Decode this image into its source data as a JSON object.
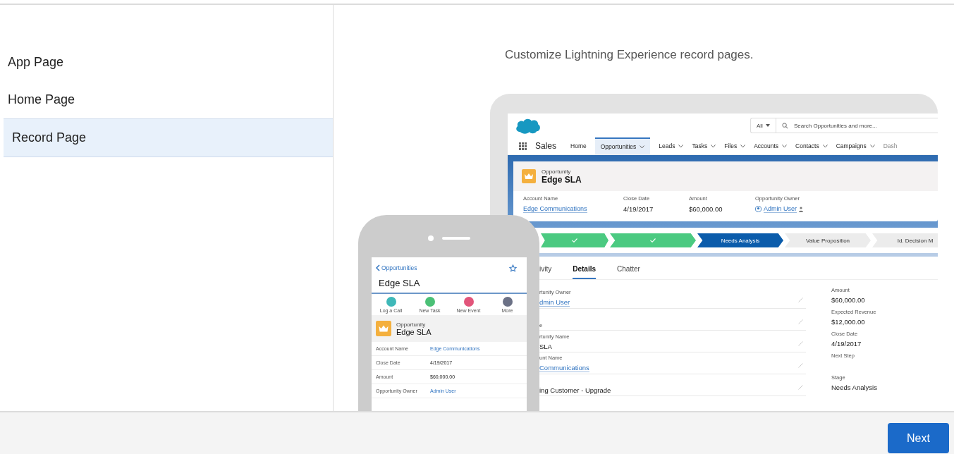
{
  "sidebar": {
    "items": [
      {
        "label": "App Page",
        "selected": false
      },
      {
        "label": "Home Page",
        "selected": false
      },
      {
        "label": "Record Page",
        "selected": true
      }
    ]
  },
  "description": "Customize Lightning Experience record pages.",
  "desktop": {
    "app_name": "Sales",
    "search_scope": "All",
    "search_placeholder": "Search Opportunities and more...",
    "nav": [
      {
        "label": "Home",
        "dropdown": false,
        "selected": false,
        "faded": false
      },
      {
        "label": "Opportunities",
        "dropdown": true,
        "selected": true,
        "faded": false
      },
      {
        "label": "Leads",
        "dropdown": true,
        "selected": false,
        "faded": false
      },
      {
        "label": "Tasks",
        "dropdown": true,
        "selected": false,
        "faded": false
      },
      {
        "label": "Files",
        "dropdown": true,
        "selected": false,
        "faded": false
      },
      {
        "label": "Accounts",
        "dropdown": true,
        "selected": false,
        "faded": false
      },
      {
        "label": "Contacts",
        "dropdown": true,
        "selected": false,
        "faded": false
      },
      {
        "label": "Campaigns",
        "dropdown": true,
        "selected": false,
        "faded": false
      },
      {
        "label": "Dash",
        "dropdown": false,
        "selected": false,
        "faded": true
      }
    ],
    "record": {
      "object": "Opportunity",
      "name": "Edge SLA"
    },
    "highlights": [
      {
        "label": "Account Name",
        "value": "Edge Communications",
        "kind": "link"
      },
      {
        "label": "Close Date",
        "value": "4/19/2017",
        "kind": "text"
      },
      {
        "label": "Amount",
        "value": "$60,000.00",
        "kind": "text"
      },
      {
        "label": "Opportunity Owner",
        "value": "Admin User",
        "kind": "user"
      }
    ],
    "path": [
      {
        "complete": true,
        "current": false
      },
      {
        "complete": true,
        "current": false
      },
      {
        "complete": false,
        "current": true,
        "label": "Needs Analysis"
      },
      {
        "complete": false,
        "current": false,
        "label": "Value Proposition"
      },
      {
        "complete": false,
        "current": false,
        "label": "Id. Decision M"
      }
    ],
    "tabs": [
      {
        "label": "ivity",
        "selected": false
      },
      {
        "label": "Details",
        "selected": true
      },
      {
        "label": "Chatter",
        "selected": false
      }
    ],
    "details_left": [
      {
        "label": "rtunity Owner",
        "value": "dmin User",
        "kind": "link"
      },
      {
        "label": "e"
      },
      {
        "label": "rtunity Name",
        "value": "SLA",
        "kind": "text"
      },
      {
        "label": "unt Name",
        "value": "Communications",
        "kind": "link"
      },
      {
        "value": "ing Customer - Upgrade",
        "kind": "text"
      }
    ],
    "details_right": [
      {
        "label": "Amount",
        "value": "$60,000.00"
      },
      {
        "label": "Expected Revenue",
        "value": "$12,000.00"
      },
      {
        "label": "Close Date",
        "value": "4/19/2017"
      },
      {
        "label": "Next Step"
      },
      {
        "label": "Stage",
        "value": "Needs Analysis"
      }
    ]
  },
  "mobile": {
    "back": "Opportunities",
    "title": "Edge SLA",
    "actions": [
      {
        "label": "Log a Call",
        "color": "#3fb8b8"
      },
      {
        "label": "New Task",
        "color": "#4bc076"
      },
      {
        "label": "New Event",
        "color": "#e2557a"
      },
      {
        "label": "More",
        "color": "#6b7186"
      }
    ],
    "record": {
      "object": "Opportunity",
      "name": "Edge SLA"
    },
    "fields": [
      {
        "label": "Account Name",
        "value": "Edge Communications",
        "kind": "link"
      },
      {
        "label": "Close Date",
        "value": "4/19/2017",
        "kind": "text"
      },
      {
        "label": "Amount",
        "value": "$60,000.00",
        "kind": "text"
      },
      {
        "label": "Opportunity Owner",
        "value": "Admin User",
        "kind": "link"
      }
    ]
  },
  "footer": {
    "button": "Next"
  }
}
